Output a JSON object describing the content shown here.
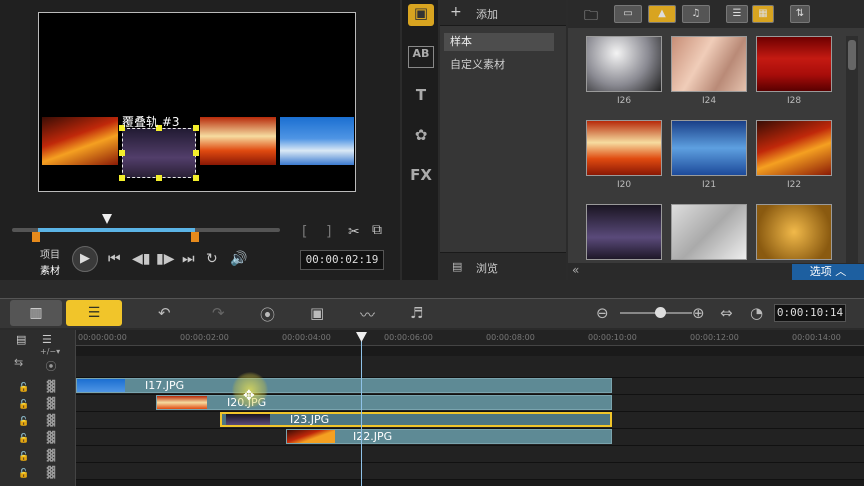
{
  "preview": {
    "overlay_label": "覆叠轨 #3",
    "mode_project": "项目",
    "mode_clip": "素材",
    "bracket_in": "[",
    "bracket_out": "]",
    "timecode": "00:00:02:19"
  },
  "library": {
    "tabs": [
      "media-icon",
      "transition-icon",
      "title-icon",
      "graphic-icon",
      "filter-icon"
    ],
    "tab_text": {
      "transition": "AB",
      "title": "T",
      "filter": "FX"
    },
    "add_label": "添加",
    "folders": [
      {
        "label": "样本",
        "selected": true
      },
      {
        "label": "自定义素材",
        "selected": false
      }
    ],
    "browse_label": "浏览",
    "options_label": "选项",
    "collapse_label": "«",
    "tiles": [
      {
        "label": "I26"
      },
      {
        "label": "I24"
      },
      {
        "label": "I28"
      },
      {
        "label": "I20"
      },
      {
        "label": "I21"
      },
      {
        "label": "I22"
      },
      {
        "label": ""
      },
      {
        "label": ""
      },
      {
        "label": ""
      }
    ]
  },
  "timeline": {
    "timecode": "0:00:10:14",
    "ruler": [
      "00:00:00:00",
      "00:00:02:00",
      "00:00:04:00",
      "00:00:06:00",
      "00:00:08:00",
      "00:00:10:00",
      "00:00:12:00",
      "00:00:14:00"
    ],
    "add_remove": "+/−▾",
    "clips": [
      {
        "label": "I17.JPG",
        "track": 1
      },
      {
        "label": "I20.JPG",
        "track": 2
      },
      {
        "label": "I23.JPG",
        "track": 3,
        "selected": true
      },
      {
        "label": "I22.JPG",
        "track": 4
      }
    ]
  },
  "colors": {
    "accent": "#f1c52a",
    "selection": "#1d5fa0",
    "clip": "#5e8a95",
    "playhead": "#8fc2e8"
  }
}
